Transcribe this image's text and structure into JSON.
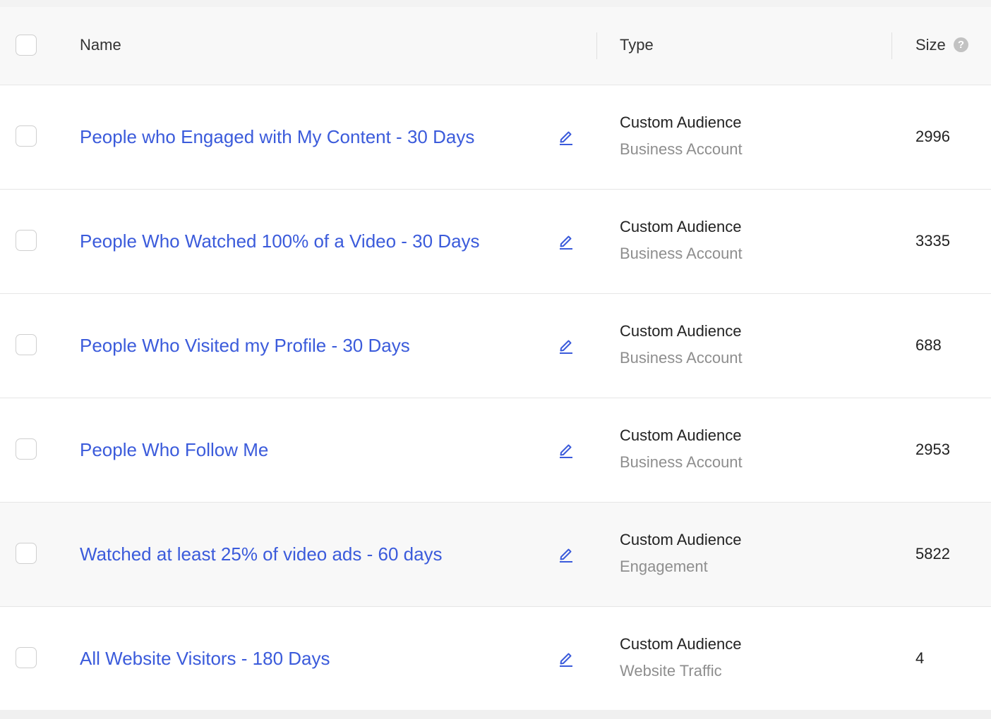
{
  "header": {
    "name_label": "Name",
    "type_label": "Type",
    "size_label": "Size",
    "help_icon": "question-circle-icon"
  },
  "colors": {
    "link": "#3b5bdb",
    "secondary_text": "#8e8e8e",
    "header_bg": "#f8f8f8",
    "row_highlight_bg": "#f8f8f8"
  },
  "rows": [
    {
      "name": "People who Engaged with My Content - 30 Days",
      "type": "Custom Audience",
      "subtype": "Business Account",
      "size": "2996",
      "highlighted": false
    },
    {
      "name": "People Who Watched 100% of a Video - 30 Days",
      "type": "Custom Audience",
      "subtype": "Business Account",
      "size": "3335",
      "highlighted": false
    },
    {
      "name": "People Who Visited my Profile - 30 Days",
      "type": "Custom Audience",
      "subtype": "Business Account",
      "size": "688",
      "highlighted": false
    },
    {
      "name": "People Who Follow Me",
      "type": "Custom Audience",
      "subtype": "Business Account",
      "size": "2953",
      "highlighted": false
    },
    {
      "name": "Watched at least 25% of video ads - 60 days",
      "type": "Custom Audience",
      "subtype": "Engagement",
      "size": "5822",
      "highlighted": true
    },
    {
      "name": "All Website Visitors - 180 Days",
      "type": "Custom Audience",
      "subtype": "Website Traffic",
      "size": "4",
      "highlighted": false
    }
  ]
}
